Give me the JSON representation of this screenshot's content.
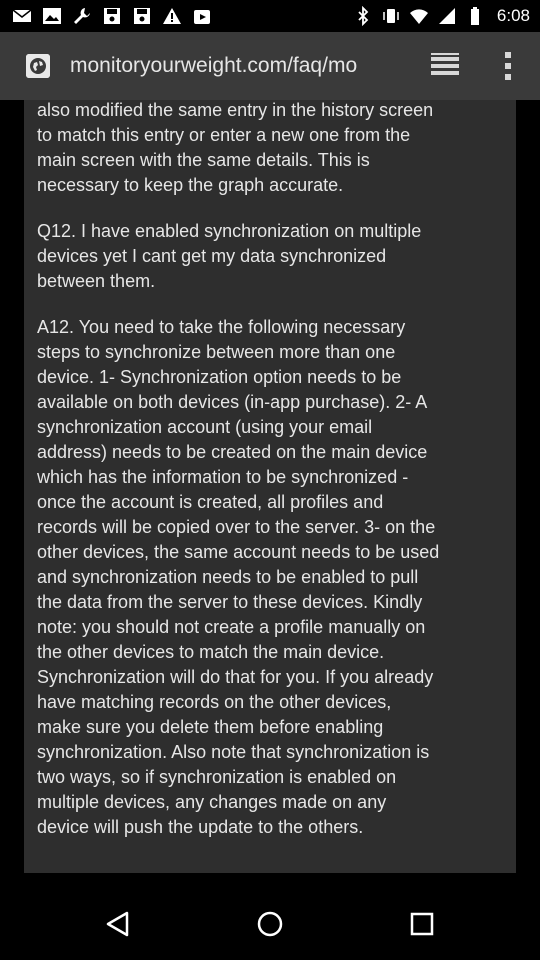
{
  "status_bar": {
    "time": "6:08",
    "left_icons": [
      "mail-icon",
      "image-icon",
      "wrench-icon",
      "save-icon",
      "save-icon",
      "warning-icon",
      "play-store-icon"
    ],
    "right_icons": [
      "bluetooth-icon",
      "vibrate-icon",
      "wifi-icon",
      "signal-icon",
      "battery-icon"
    ]
  },
  "toolbar": {
    "url": "monitoryourweight.com/faq/mo",
    "site_icon": "globe-icon",
    "reader_icon": "reader-mode-icon",
    "menu_icon": "more-vertical-icon"
  },
  "content": {
    "paragraphs": [
      {
        "kind": "answer-tail",
        "text": "also modified the same entry in the history screen\nto match this entry or enter a new one from the\nmain screen with the same details. This is\nnecessary to keep the graph accurate."
      },
      {
        "kind": "question",
        "text": "Q12. I have enabled synchronization on multiple\ndevices yet I cant get my data synchronized\nbetween them."
      },
      {
        "kind": "answer",
        "text": "A12. You need to take the following necessary\nsteps to synchronize between more than one\ndevice. 1- Synchronization option needs to be\navailable on both devices (in-app purchase). 2- A\nsynchronization account (using your email\naddress) needs to be created on the main device\nwhich has the information to be synchronized -\nonce the account is created, all profiles and\nrecords will be copied over to the server. 3- on the\nother devices, the same account needs to be used\nand synchronization needs to be enabled to pull\nthe data from the server to these devices. Kindly\nnote: you should not create a profile manually on\nthe other devices to match the main device.\nSynchronization will do that for you. If you already\nhave matching records on the other devices,\nmake sure you delete them before enabling\nsynchronization. Also note that synchronization is\ntwo ways, so if synchronization is enabled on\nmultiple devices, any changes made on any\ndevice will push the update to the others."
      }
    ]
  },
  "nav_bar": {
    "back_icon": "back-triangle-icon",
    "home_icon": "home-circle-icon",
    "recent_icon": "recent-apps-square-icon"
  },
  "colors": {
    "toolbar_bg": "#3a3a3a",
    "card_bg": "#2e2e2e",
    "text": "#e6e6e6",
    "page_bg": "#000000"
  }
}
